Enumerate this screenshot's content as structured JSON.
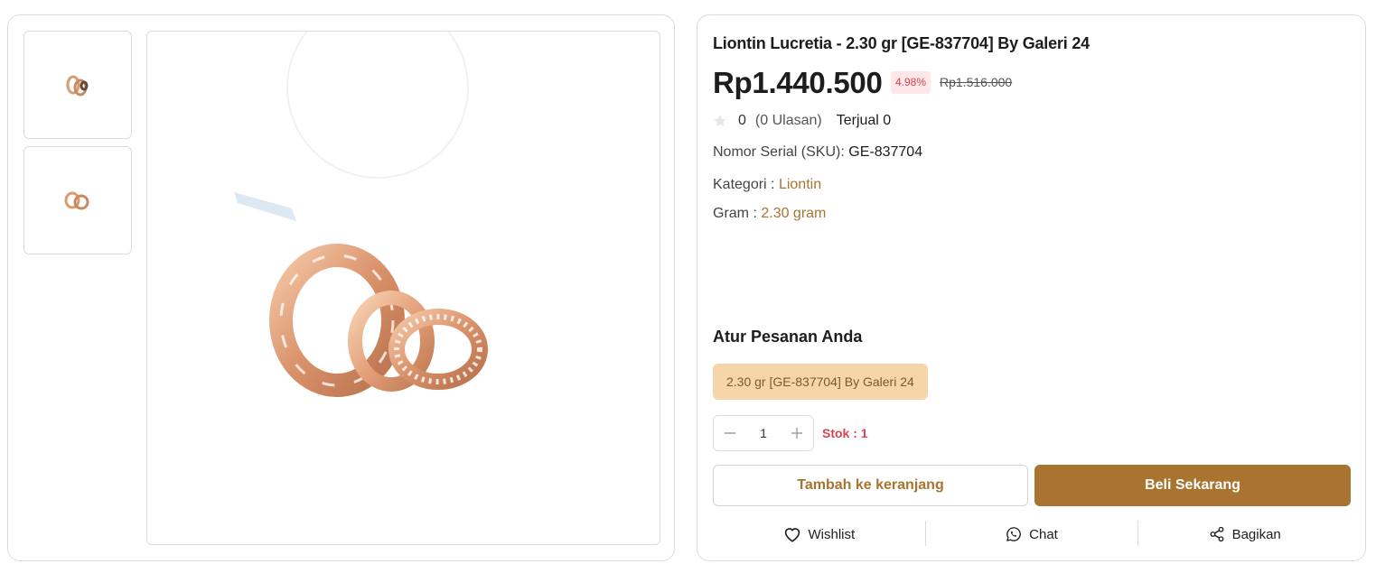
{
  "product": {
    "title": "Liontin Lucretia - 2.30 gr [GE-837704] By Galeri 24",
    "price": "Rp1.440.500",
    "discount": "4.98%",
    "original_price": "Rp1.516.000",
    "rating": "0",
    "reviews": "(0 Ulasan)",
    "sold": "Terjual 0",
    "sku_label": "Nomor Serial (SKU):",
    "sku_value": "GE-837704",
    "category_label": "Kategori :",
    "category_value": "Liontin",
    "gram_label": "Gram :",
    "gram_value": "2.30 gram"
  },
  "order": {
    "heading": "Atur Pesanan Anda",
    "variant": "2.30 gr [GE-837704] By Galeri 24",
    "quantity": "1",
    "stock": "Stok : 1"
  },
  "buttons": {
    "add_to_cart": "Tambah ke keranjang",
    "buy_now": "Beli Sekarang"
  },
  "actions": {
    "wishlist": "Wishlist",
    "chat": "Chat",
    "share": "Bagikan"
  },
  "colors": {
    "accent": "#a8742f",
    "variant_bg": "#f6d5a8",
    "discount_text": "#d9434f",
    "discount_bg": "#fde7e8"
  }
}
